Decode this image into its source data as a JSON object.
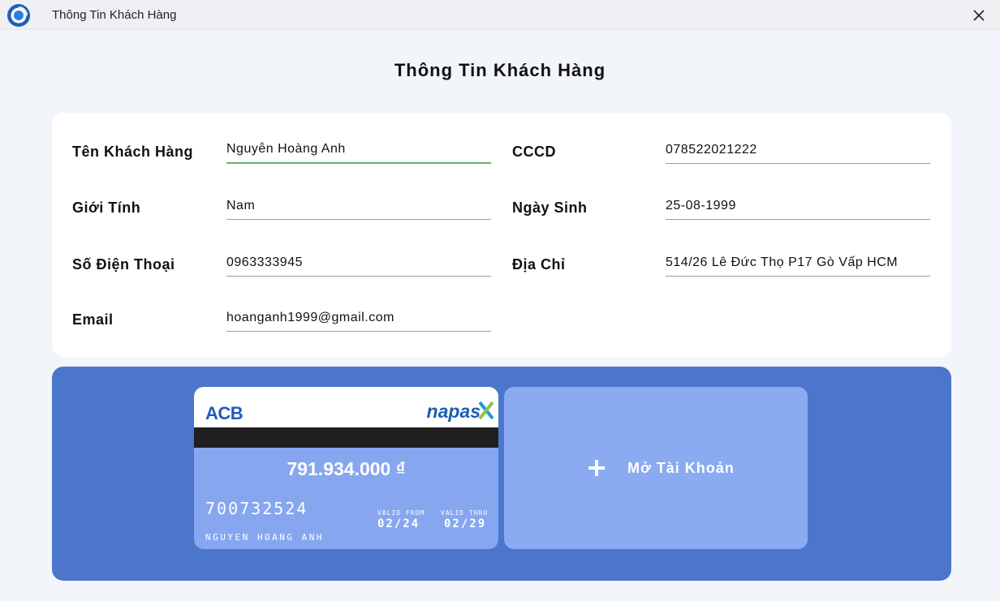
{
  "window": {
    "title": "Thông Tin Khách Hàng",
    "logo_icon": "app-logo-icon",
    "close_icon": "close-icon"
  },
  "page": {
    "title": "Thông Tin Khách Hàng"
  },
  "form": {
    "name": {
      "label": "Tên Khách Hàng",
      "value": "Nguyễn Hoàng Anh"
    },
    "cccd": {
      "label": "CCCD",
      "value": "078522021222"
    },
    "gender": {
      "label": "Giới Tính",
      "value": "Nam"
    },
    "dob": {
      "label": "Ngày Sinh",
      "value": "25-08-1999"
    },
    "phone": {
      "label": "Số Điện Thoại",
      "value": "0963333945"
    },
    "address": {
      "label": "Địa Chỉ",
      "value": "514/26 Lê Đức Thọ P17 Gò Vấp HCM"
    },
    "email": {
      "label": "Email",
      "value": "hoanganh1999@gmail.com"
    }
  },
  "card": {
    "bank": "ACB",
    "network": "napas",
    "balance": "791.934.000 ₫",
    "number": "700732524",
    "valid_from_label": "VALID FROM",
    "valid_from": "02/24",
    "valid_thru_label": "VALID THRU",
    "valid_thru": "02/29",
    "holder": "NGUYEN HOANG ANH"
  },
  "open_account": {
    "label": "Mở Tài Khoản",
    "icon": "plus-icon"
  },
  "colors": {
    "background": "#f2f5f9",
    "card_panel": "#4c75cc",
    "card_body": "#87a6f0",
    "active_underline": "#5cb85c"
  }
}
